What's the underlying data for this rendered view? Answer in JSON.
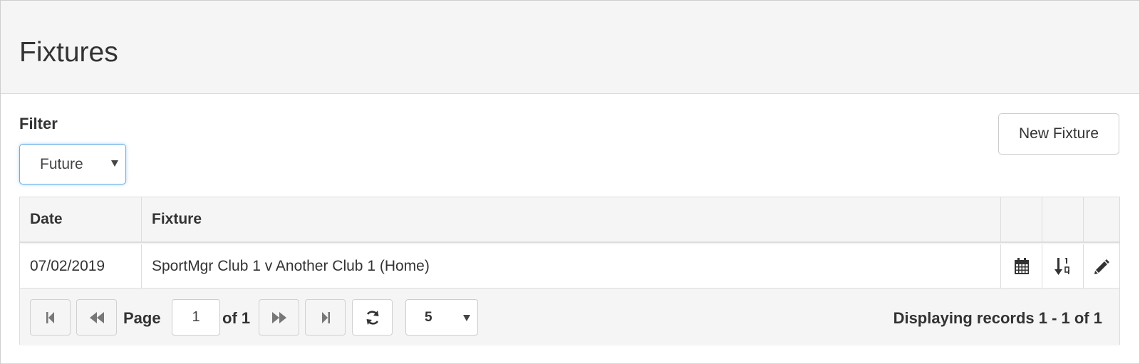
{
  "panel": {
    "title": "Fixtures"
  },
  "filter": {
    "label": "Filter",
    "selected": "Future"
  },
  "actions": {
    "new_fixture": "New Fixture"
  },
  "table": {
    "columns": [
      "Date",
      "Fixture",
      "",
      "",
      ""
    ],
    "rows": [
      {
        "date": "07/02/2019",
        "fixture": "SportMgr Club 1 v Another Club 1 (Home)",
        "icons": [
          "calendar-icon",
          "sort-numeric-icon",
          "pencil-icon"
        ]
      }
    ]
  },
  "pager": {
    "page_label": "Page",
    "page_value": "1",
    "of_label": "of 1",
    "page_size": "5",
    "displaying": "Displaying records 1 - 1 of 1",
    "icons": [
      "first-page-icon",
      "previous-page-icon",
      "next-page-icon",
      "last-page-icon",
      "refresh-icon"
    ]
  },
  "colors": {
    "focus_border": "#66afe9",
    "header_bg": "#f5f5f5",
    "border": "#dddddd"
  }
}
